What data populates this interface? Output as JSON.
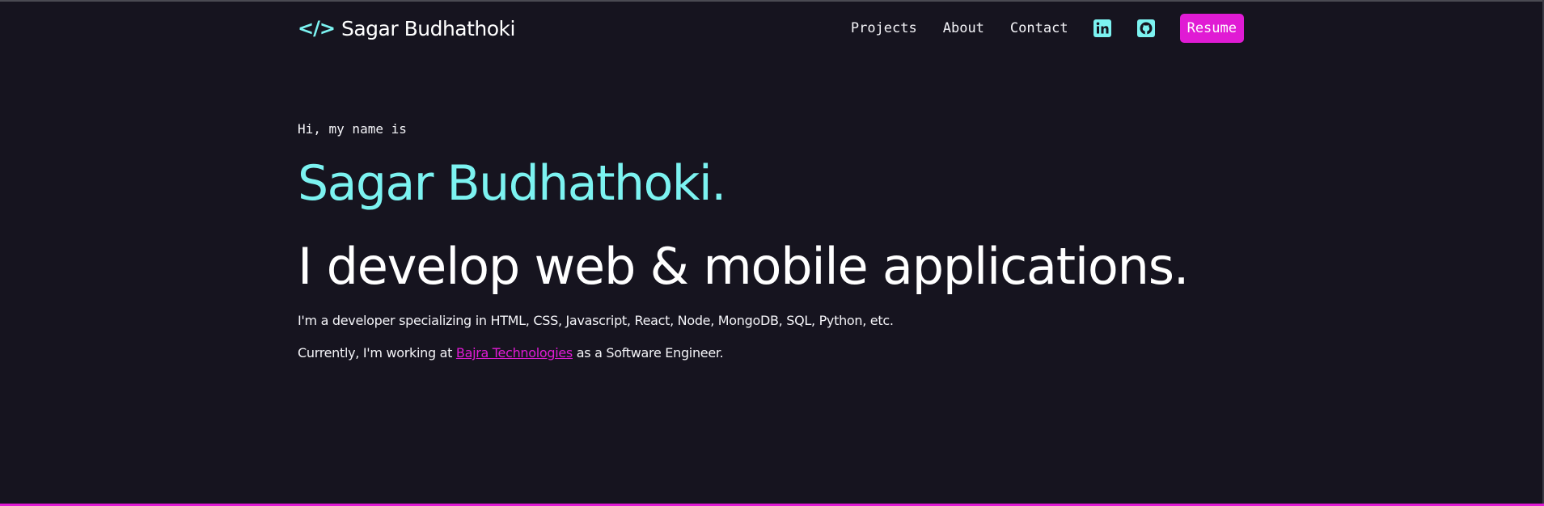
{
  "header": {
    "brand_icon": "</>",
    "brand_name": "Sagar Budhathoki",
    "nav": [
      {
        "label": "Projects"
      },
      {
        "label": "About"
      },
      {
        "label": "Contact"
      }
    ],
    "social": [
      {
        "icon": "linkedin-icon"
      },
      {
        "icon": "github-icon"
      }
    ],
    "resume_label": "Resume"
  },
  "hero": {
    "greeting": "Hi, my name is",
    "name": "Sagar Budhathoki.",
    "tagline": "I develop web & mobile applications.",
    "intro": "I'm a developer specializing in HTML, CSS, Javascript, React, Node, MongoDB, SQL, Python, etc.",
    "current_prefix": "Currently, I'm working at ",
    "company": "Bajra Technologies",
    "current_suffix": " as a Software Engineer."
  },
  "colors": {
    "background": "#16141f",
    "accent_cyan": "#7cf3f1",
    "accent_magenta": "#e01bd4",
    "text": "#f4f4f8"
  }
}
